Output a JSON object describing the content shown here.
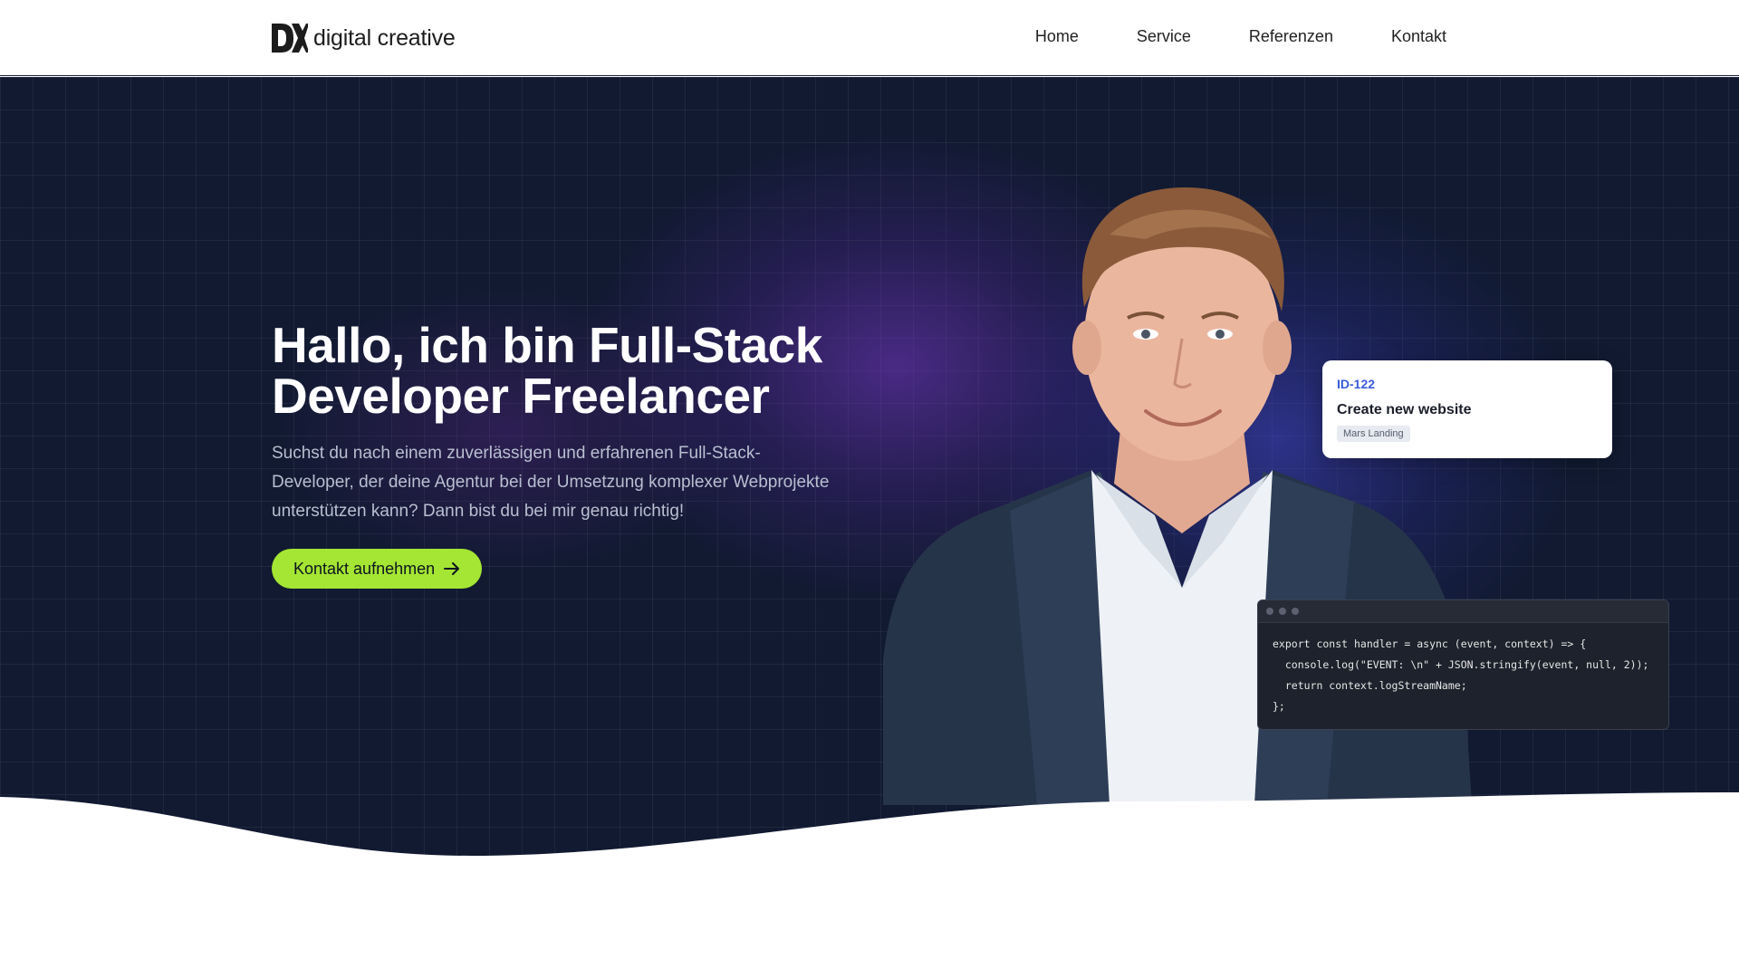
{
  "header": {
    "logo_text": "digital creative",
    "nav": [
      "Home",
      "Service",
      "Referenzen",
      "Kontakt"
    ]
  },
  "hero": {
    "headline": "Hallo, ich bin Full-Stack Developer Freelancer",
    "subtext": "Suchst du nach einem zuverlässigen und erfahrenen Full-Stack-Developer, der deine Agentur bei der Umsetzung komplexer Webprojekte unterstützen kann? Dann bist du bei mir genau richtig!",
    "cta_label": "Kontakt aufnehmen"
  },
  "task_card": {
    "id": "ID-122",
    "title": "Create new website",
    "tag": "Mars Landing"
  },
  "code_card": {
    "lines": [
      "export const handler = async (event, context) => {",
      "  console.log(\"EVENT: \\n\" + JSON.stringify(event, null, 2));",
      "  return context.logStreamName;",
      "};"
    ]
  },
  "colors": {
    "hero_bg": "#111a31",
    "accent_green": "#a4e633",
    "task_id_blue": "#3a5bd9"
  },
  "icons": {
    "logo": "dc-logo-mark",
    "cta": "arrow-right-icon"
  }
}
